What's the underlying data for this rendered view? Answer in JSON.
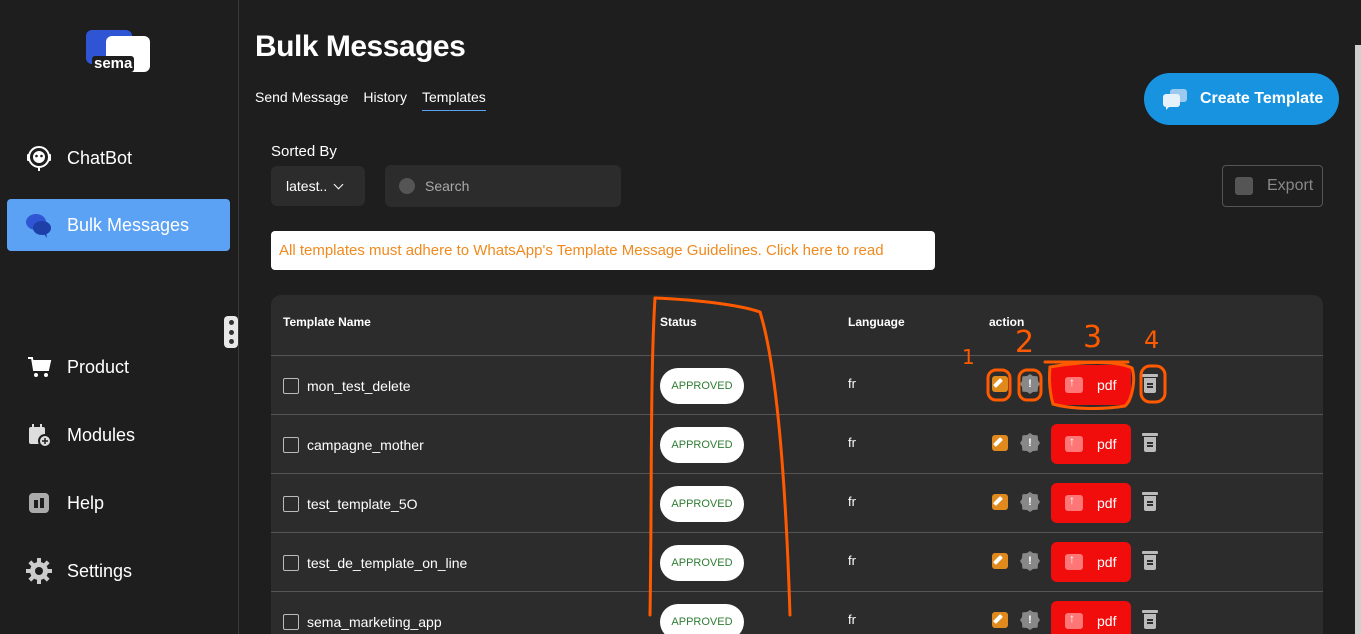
{
  "brand": {
    "logo_text": "sema"
  },
  "sidebar": {
    "items": [
      {
        "label": "ChatBot"
      },
      {
        "label": "Bulk Messages"
      },
      {
        "label": "Product"
      },
      {
        "label": "Modules"
      },
      {
        "label": "Help"
      },
      {
        "label": "Settings"
      }
    ]
  },
  "header": {
    "title": "Bulk Messages",
    "tabs": [
      {
        "label": "Send Message"
      },
      {
        "label": "History"
      },
      {
        "label": "Templates"
      }
    ],
    "create_label": "Create Template"
  },
  "toolbar": {
    "sorted_label": "Sorted By",
    "sort_value": "latest..",
    "search_placeholder": "Search",
    "export_label": "Export"
  },
  "notice": "All templates must adhere to WhatsApp's Template Message Guidelines. Click here to read",
  "table": {
    "headers": {
      "name": "Template Name",
      "status": "Status",
      "language": "Language",
      "action": "action"
    },
    "rows": [
      {
        "name": "mon_test_delete",
        "status": "APPROVED",
        "language": "fr",
        "pdf": "pdf"
      },
      {
        "name": "campagne_mother",
        "status": "APPROVED",
        "language": "fr",
        "pdf": "pdf"
      },
      {
        "name": "test_template_5O",
        "status": "APPROVED",
        "language": "fr",
        "pdf": "pdf"
      },
      {
        "name": "test_de_template_on_line",
        "status": "APPROVED",
        "language": "fr",
        "pdf": "pdf"
      },
      {
        "name": "sema_marketing_app",
        "status": "APPROVED",
        "language": "fr",
        "pdf": "pdf"
      }
    ]
  },
  "annotations": {
    "n1": "1",
    "n2": "2",
    "n3": "3",
    "n4": "4",
    "info_glyph": "!"
  },
  "colors": {
    "accent": "#5ba2f5",
    "create": "#1793e0",
    "pdf": "#f20d0d",
    "approved_text": "#2e7d32",
    "annotation": "#ff5a00"
  }
}
